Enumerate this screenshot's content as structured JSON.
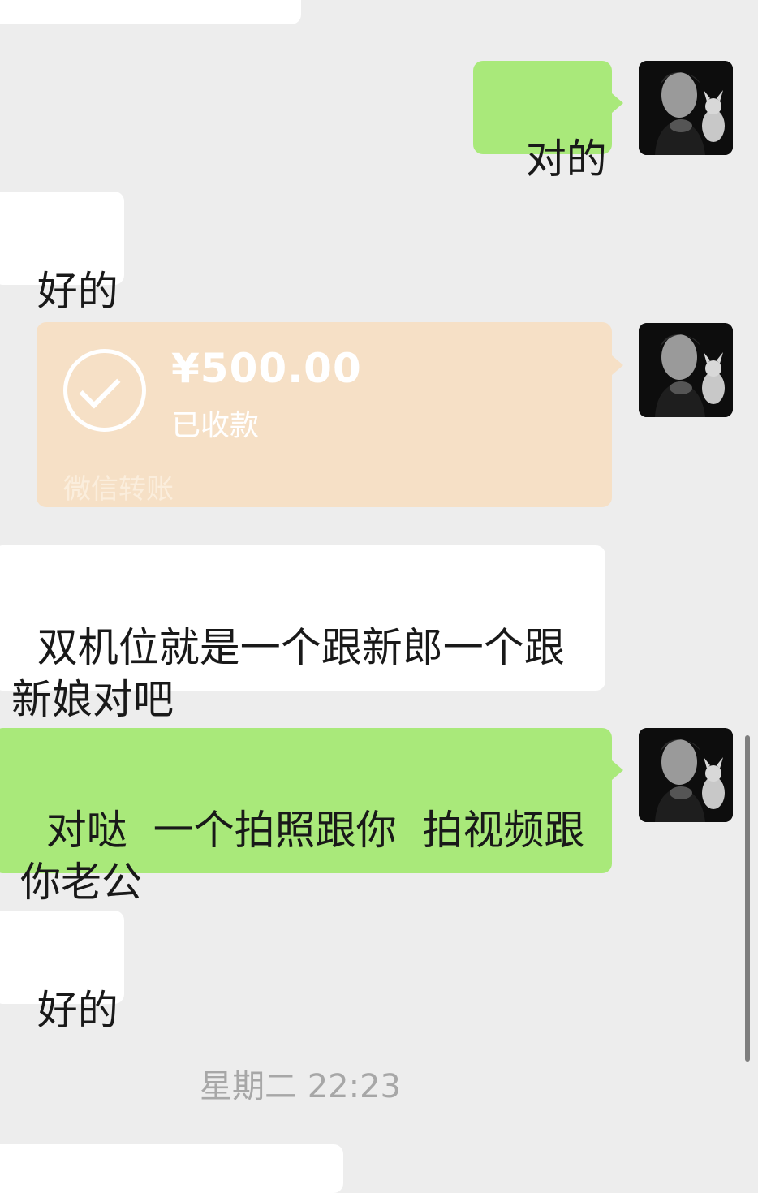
{
  "messages": [
    {
      "text": "对的"
    },
    {
      "text": "好的"
    },
    {
      "text": "双机位就是一个跟新郎一个跟\n新娘对吧"
    },
    {
      "text": "对哒  一个拍照跟你  拍视频跟\n你老公"
    },
    {
      "text": "好的"
    }
  ],
  "transfer": {
    "amount": "¥500.00",
    "status": "已收款",
    "label": "微信转账"
  },
  "timestamp": "星期二 22:23",
  "colors": {
    "background": "#ededed",
    "sent_bubble": "#a9e97a",
    "received_bubble": "#ffffff",
    "transfer_card": "#f6e0c6"
  },
  "icons": [
    "avatar-photo",
    "check-circle-icon"
  ]
}
